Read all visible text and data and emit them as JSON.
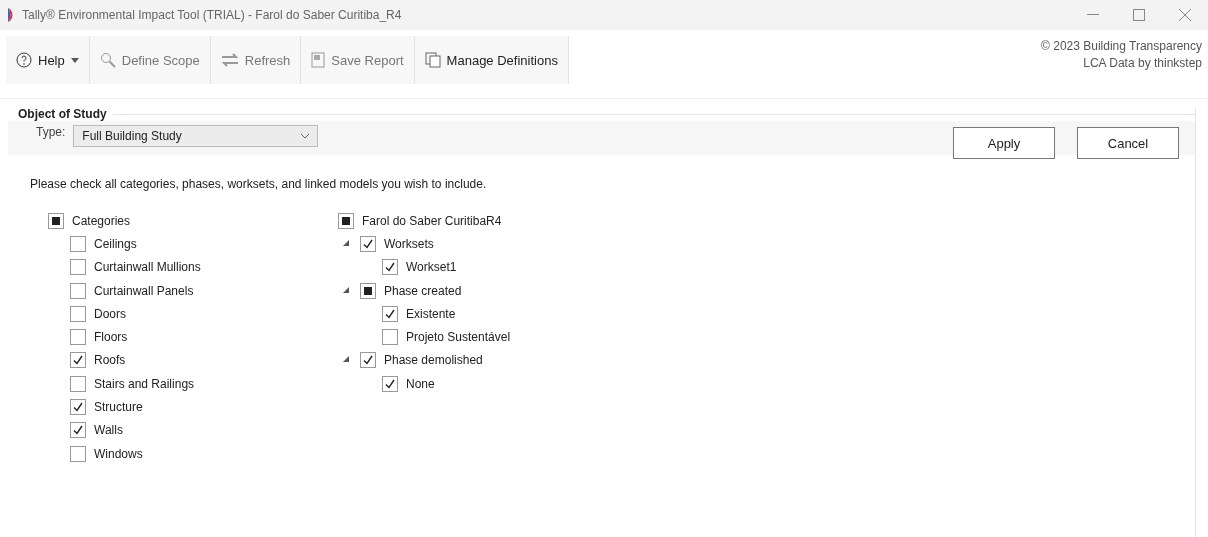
{
  "window": {
    "title": "Tally® Environmental Impact Tool (TRIAL) - Farol do Saber Curitiba_R4"
  },
  "toolbar": [
    {
      "label": "Help",
      "kind": "help",
      "disabled": false
    },
    {
      "label": "Define Scope",
      "kind": "search",
      "disabled": true
    },
    {
      "label": "Refresh",
      "kind": "refresh",
      "disabled": true
    },
    {
      "label": "Save Report",
      "kind": "save",
      "disabled": true
    },
    {
      "label": "Manage Definitions",
      "kind": "copy",
      "disabled": false
    }
  ],
  "credits": [
    "© 2023 Building Transparency",
    "LCA Data by thinkstep"
  ],
  "object_of_study": {
    "title": "Object of Study",
    "type_label": "Type:",
    "type_value": "Full Building Study",
    "buttons": [
      "Apply",
      "Cancel"
    ],
    "instruction": "Please check all categories, phases, worksets, and linked models you wish to include.",
    "trees": [
      {
        "label": "Categories",
        "partial": true,
        "children": [
          {
            "label": "Ceilings",
            "checked": false
          },
          {
            "label": "Curtainwall Mullions",
            "checked": false
          },
          {
            "label": "Curtainwall Panels",
            "checked": false
          },
          {
            "label": "Doors",
            "checked": false
          },
          {
            "label": "Floors",
            "checked": false
          },
          {
            "label": "Roofs",
            "checked": true
          },
          {
            "label": "Stairs and Railings",
            "checked": false
          },
          {
            "label": "Structure",
            "checked": true
          },
          {
            "label": "Walls",
            "checked": true
          },
          {
            "label": "Windows",
            "checked": false
          }
        ]
      },
      {
        "label": "Farol do Saber CuritibaR4",
        "partial": true,
        "children": [
          {
            "label": "Worksets",
            "checked": true,
            "expanded": true,
            "children": [
              {
                "label": "Workset1",
                "checked": true
              }
            ]
          },
          {
            "label": "Phase created",
            "partial": true,
            "expanded": true,
            "children": [
              {
                "label": "Existente",
                "checked": true
              },
              {
                "label": "Projeto Sustentável",
                "checked": false
              }
            ]
          },
          {
            "label": "Phase demolished",
            "checked": true,
            "expanded": true,
            "children": [
              {
                "label": "None",
                "checked": true
              }
            ]
          }
        ]
      }
    ]
  }
}
